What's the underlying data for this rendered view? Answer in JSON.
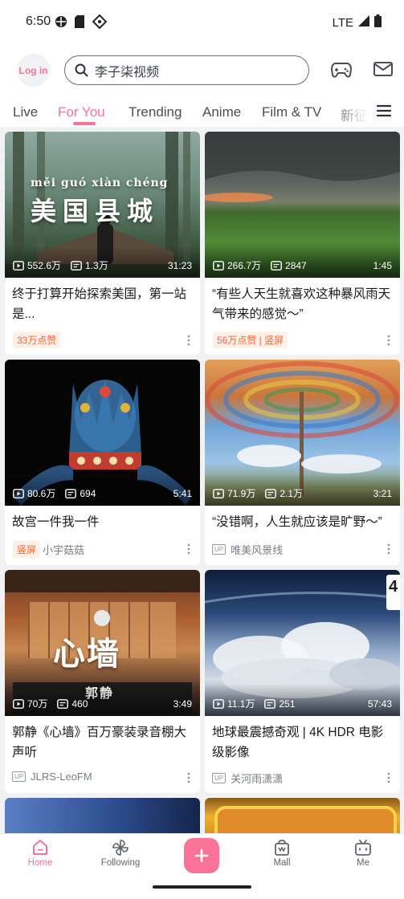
{
  "status_bar": {
    "time": "6:50",
    "network": "LTE"
  },
  "header": {
    "login_label": "Log in",
    "search_placeholder": "李子柒视频"
  },
  "tabs": [
    {
      "label": "Live"
    },
    {
      "label": "For You",
      "active": true
    },
    {
      "label": "Trending"
    },
    {
      "label": "Anime"
    },
    {
      "label": "Film & TV"
    },
    {
      "label": "新征"
    }
  ],
  "cards": [
    {
      "overlay_pinyin": "měi   guó  xiàn chéng",
      "overlay_text": "美国县城",
      "views": "552.6万",
      "danmaku": "1.3万",
      "duration": "31:23",
      "title": "终于打算开始探索美国，第一站是...",
      "tag": "33万点赞"
    },
    {
      "views": "266.7万",
      "danmaku": "2847",
      "duration": "1:45",
      "title": "“有些人天生就喜欢这种暴风雨天气带来的感觉～”",
      "tag": "56万点赞 | 竖屏"
    },
    {
      "views": "80.6万",
      "danmaku": "694",
      "duration": "5:41",
      "title": "故宫一件我一件",
      "tag": "竖屏",
      "uploader": "小宇菇菇"
    },
    {
      "views": "71.9万",
      "danmaku": "2.1万",
      "duration": "3:21",
      "title": "“没错啊，人生就应该是旷野～”",
      "badge": "UP",
      "uploader": "唯美风景线"
    },
    {
      "overlay_text": "心墙",
      "overlay_sub": "郭静",
      "views": "70万",
      "danmaku": "460",
      "duration": "3:49",
      "title": "郭静《心墙》百万豪装录音棚大声听",
      "badge": "UP",
      "uploader": "JLRS-LeoFM"
    },
    {
      "corner_text": "4",
      "views": "11.1万",
      "danmaku": "251",
      "duration": "57:43",
      "title": "地球最震撼奇观 | 4K HDR 电影级影像",
      "badge": "UP",
      "uploader": "关河雨潇潇"
    }
  ],
  "bottom_nav": [
    {
      "label": "Home",
      "icon": "home-icon",
      "active": true
    },
    {
      "label": "Following",
      "icon": "pinwheel-icon"
    },
    {
      "label": "",
      "icon": "plus-icon"
    },
    {
      "label": "Mall",
      "icon": "shopping-bag-icon"
    },
    {
      "label": "Me",
      "icon": "tv-face-icon"
    }
  ],
  "colors": {
    "accent": "#fb7299",
    "tag_text": "#ff6633",
    "tag_bg": "#fff0e8"
  }
}
